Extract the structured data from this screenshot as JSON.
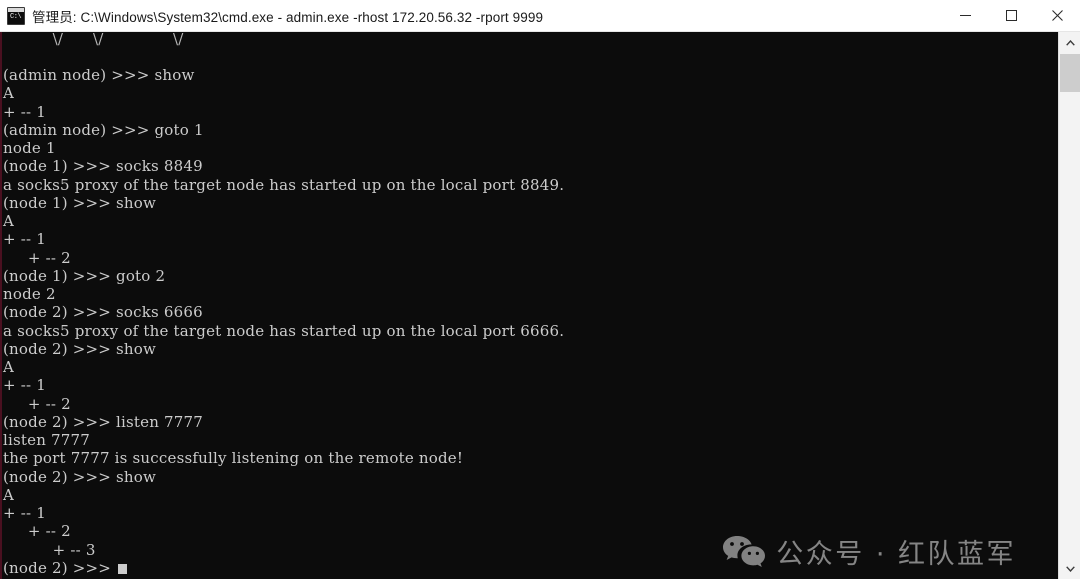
{
  "window": {
    "title": "管理员: C:\\Windows\\System32\\cmd.exe - admin.exe  -rhost 172.20.56.32 -rport 9999",
    "icon": "cmd-icon",
    "icon_text": "C:\\",
    "minimize_label": "Minimize",
    "maximize_label": "Maximize",
    "close_label": "Close"
  },
  "console": {
    "background_color": "#0c0c0c",
    "text_color": "#cccccc",
    "lines": [
      "          \\/      \\/              \\/",
      "",
      "(admin node) >>> show",
      "A",
      "+ -- 1",
      "(admin node) >>> goto 1",
      "node 1",
      "(node 1) >>> socks 8849",
      "a socks5 proxy of the target node has started up on the local port 8849.",
      "(node 1) >>> show",
      "A",
      "+ -- 1",
      "     + -- 2",
      "(node 1) >>> goto 2",
      "node 2",
      "(node 2) >>> socks 6666",
      "a socks5 proxy of the target node has started up on the local port 6666.",
      "(node 2) >>> show",
      "A",
      "+ -- 1",
      "     + -- 2",
      "(node 2) >>> listen 7777",
      "listen 7777",
      "the port 7777 is successfully listening on the remote node!",
      "(node 2) >>> show",
      "A",
      "+ -- 1",
      "     + -- 2",
      "          + -- 3"
    ],
    "prompt": "(node 2) >>> ",
    "cursor": "block-cursor"
  },
  "watermark": {
    "logo": "wechat-logo",
    "text": "公众号 · 红队蓝军"
  },
  "scrollbar": {
    "up_arrow": "chevron-up-icon",
    "down_arrow": "chevron-down-icon",
    "thumb": "scrollbar-thumb"
  }
}
